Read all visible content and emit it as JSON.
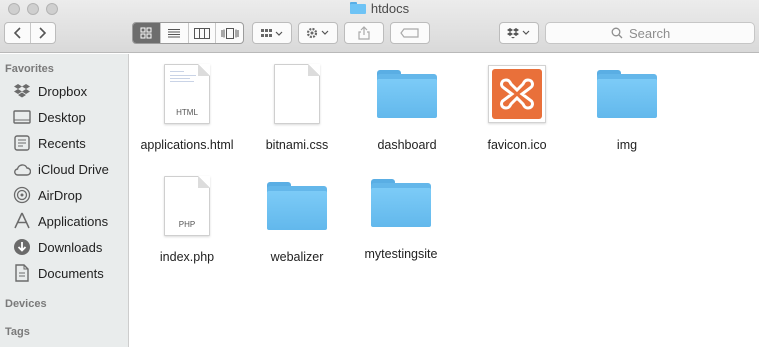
{
  "window": {
    "title": "htdocs"
  },
  "toolbar": {
    "back_icon": "chevron-left",
    "forward_icon": "chevron-right",
    "views": [
      "icon-view",
      "list-view",
      "column-view",
      "cover-flow-view"
    ],
    "active_view": "icon-view",
    "search": {
      "placeholder": "Search",
      "value": ""
    }
  },
  "sidebar": {
    "sections": [
      {
        "label": "Favorites"
      },
      {
        "label": "Devices"
      },
      {
        "label": "Tags"
      }
    ],
    "favorites": [
      {
        "label": "Dropbox",
        "icon": "dropbox-icon"
      },
      {
        "label": "Desktop",
        "icon": "desktop-icon"
      },
      {
        "label": "Recents",
        "icon": "recents-icon"
      },
      {
        "label": "iCloud Drive",
        "icon": "cloud-icon"
      },
      {
        "label": "AirDrop",
        "icon": "airdrop-icon"
      },
      {
        "label": "Applications",
        "icon": "applications-icon"
      },
      {
        "label": "Downloads",
        "icon": "downloads-icon"
      },
      {
        "label": "Documents",
        "icon": "documents-icon"
      }
    ]
  },
  "files": [
    {
      "name": "applications.html",
      "kind": "document",
      "ext": "HTML"
    },
    {
      "name": "bitnami.css",
      "kind": "document",
      "ext": ""
    },
    {
      "name": "dashboard",
      "kind": "folder"
    },
    {
      "name": "favicon.ico",
      "kind": "image"
    },
    {
      "name": "img",
      "kind": "folder"
    },
    {
      "name": "index.php",
      "kind": "document",
      "ext": "PHP"
    },
    {
      "name": "webalizer",
      "kind": "folder"
    },
    {
      "name": "mytestingsite",
      "kind": "folder"
    }
  ],
  "colors": {
    "folder": "#6ec3f5",
    "sidebar_bg": "#e9ecec",
    "favicon": "#e9703a",
    "selected_view": "#6d6d6d"
  }
}
